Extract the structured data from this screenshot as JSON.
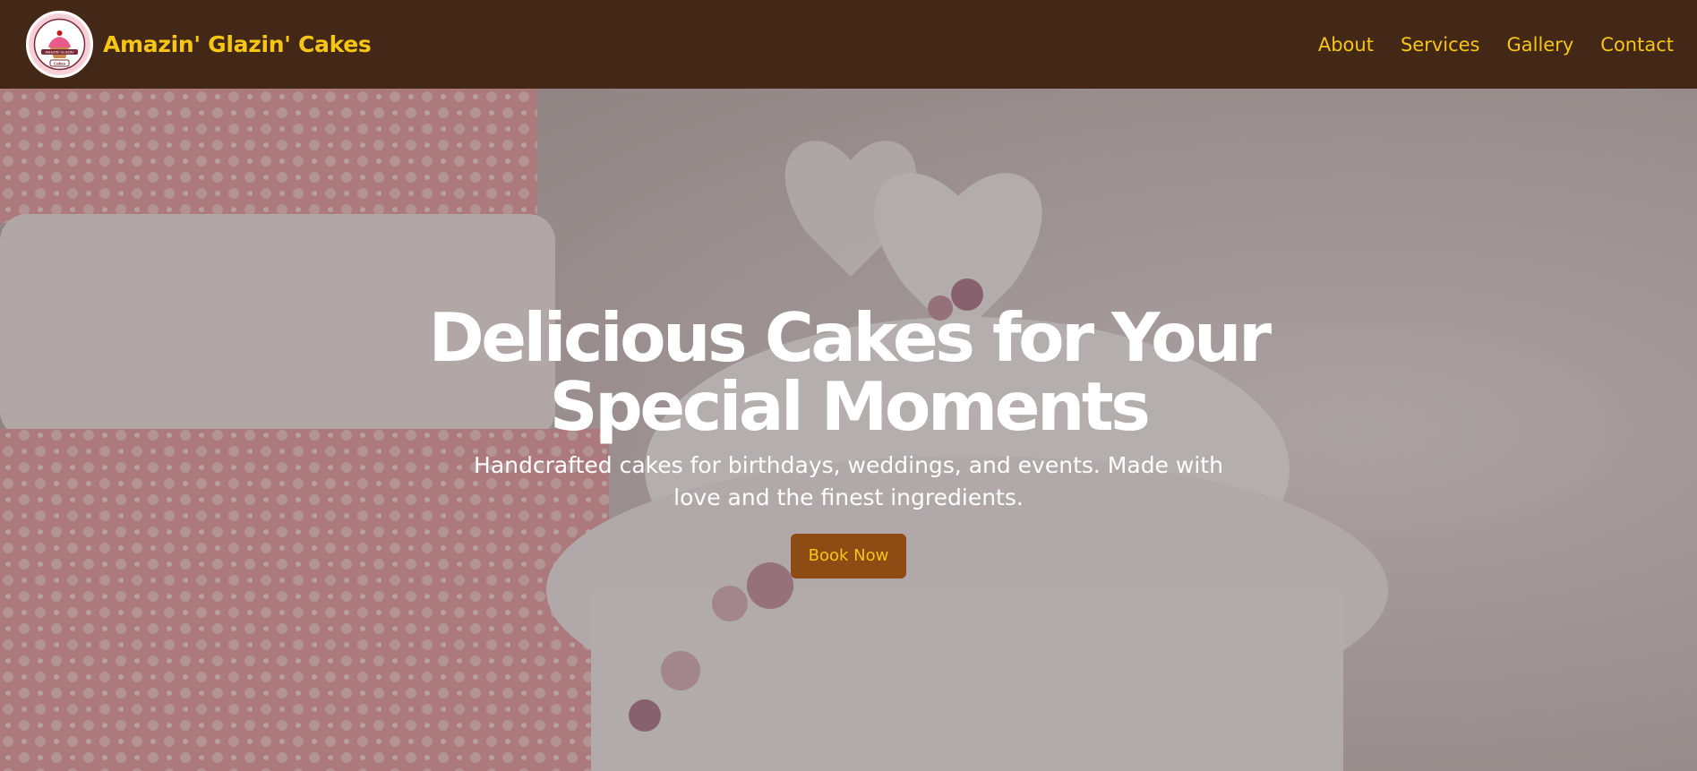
{
  "brand": {
    "name": "Amazin' Glazin' Cakes",
    "logo_icon": "cupcake-logo-icon",
    "logo_text": "AMAZIN' GLAZIN'",
    "logo_subtext": "Cakes"
  },
  "nav": {
    "items": [
      {
        "label": "About"
      },
      {
        "label": "Services"
      },
      {
        "label": "Gallery"
      },
      {
        "label": "Contact"
      }
    ]
  },
  "hero": {
    "title": "Delicious Cakes for Your Special Moments",
    "subtitle": "Handcrafted cakes for birthdays, weddings, and events. Made with love and the finest ingredients.",
    "button_label": "Book Now",
    "background_icon": "wedding-cake-photo"
  },
  "colors": {
    "navbar_bg": "#432717",
    "accent_yellow": "#f7c614",
    "button_bg": "#8e4b14",
    "text_white": "#ffffff"
  }
}
